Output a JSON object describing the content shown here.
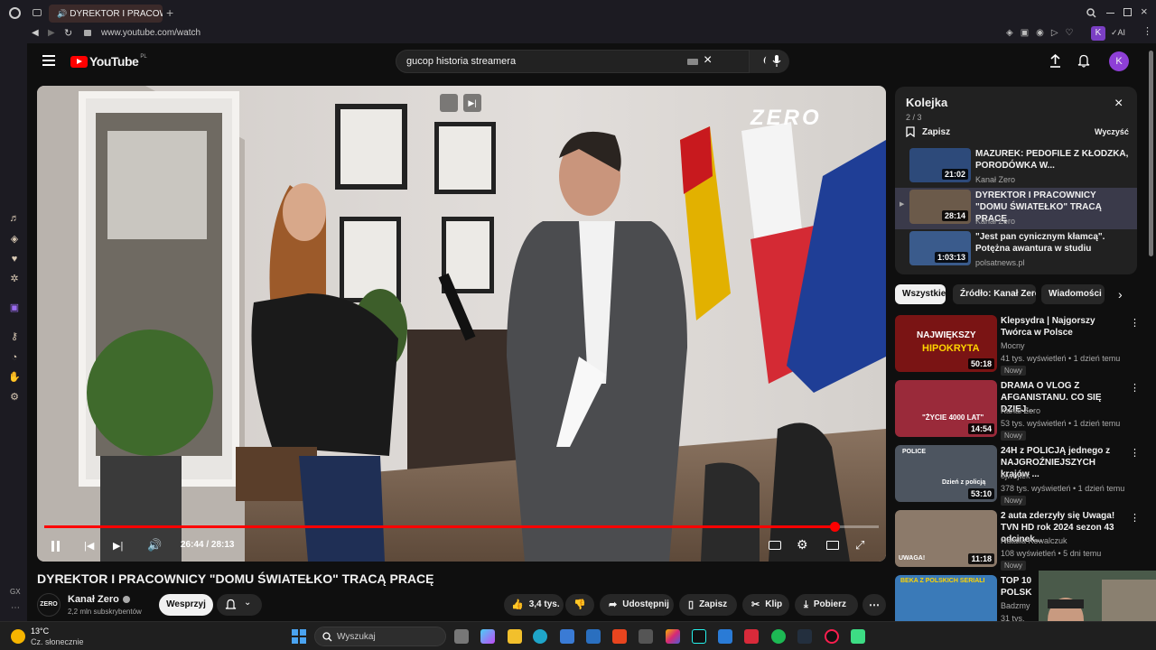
{
  "browser": {
    "tab_title": "DYREKTOR I PRACOWN",
    "url": "www.youtube.com/watch",
    "ai_label": "AI",
    "profile_initial": "K",
    "gx_label": "GX"
  },
  "youtube": {
    "logo_text": "YouTube",
    "region": "PL",
    "search_value": "gucop historia streamera",
    "avatar_initial": "K"
  },
  "player": {
    "watermark": "ZERO",
    "time_display": "26:44 / 28:13",
    "progress_fraction": 0.9473
  },
  "video": {
    "title": "DYREKTOR I PRACOWNICY \"DOMU ŚWIATEŁKO\" TRACĄ PRACĘ",
    "channel": "Kanał Zero",
    "subscribers": "2,2 mln subskrybentów",
    "support_label": "Wesprzyj",
    "likes": "3,4 tys.",
    "share_label": "Udostępnij",
    "save_label": "Zapisz",
    "clip_label": "Klip",
    "download_label": "Pobierz",
    "channel_logo_text": "ZERO"
  },
  "queue": {
    "title": "Kolejka",
    "position": "2 / 3",
    "save_label": "Zapisz",
    "clear_label": "Wyczyść",
    "items": [
      {
        "title": "MAZUREK: PEDOFILE Z KŁODZKA, PORODÓWKA W...",
        "channel": "Kanał Zero",
        "duration": "21:02",
        "color": "#2d4a7a"
      },
      {
        "title": "DYREKTOR I PRACOWNICY \"DOMU ŚWIATEŁKO\" TRACĄ PRACĘ",
        "channel": "Kanał Zero",
        "duration": "28:14",
        "color": "#6b5a4a"
      },
      {
        "title": "\"Jest pan cynicznym kłamcą\". Potężna awantura w studiu",
        "channel": "polsatnews.pl",
        "duration": "1:03:13",
        "color": "#3a5b8c"
      }
    ]
  },
  "chips": [
    "Wszystkie",
    "Źródło: Kanał Zero",
    "Wiadomości z"
  ],
  "recommendations": [
    {
      "title": "Klepsydra | Najgorszy Twórca w Polsce",
      "channel": "Mocny",
      "meta": "41 tys. wyświetleń • 1 dzień temu",
      "badge": "Nowy",
      "duration": "50:18",
      "thumb_text1": "NAJWIĘKSZY",
      "thumb_text2": "HIPOKRYTA",
      "color": "#7a1414"
    },
    {
      "title": "DRAMA O VLOG Z AFGANISTANU. CO SIĘ DZIEJ...",
      "channel": "Kanał Zero",
      "meta": "53 tys. wyświetleń • 1 dzień temu",
      "badge": "Nowy",
      "duration": "14:54",
      "thumb_text1": "\"ŻYCIE 4000 LAT\"",
      "thumb_text2": "",
      "color": "#9a2a3a"
    },
    {
      "title": "24H z POLICJĄ jednego z NAJGROŹNIEJSZYCH krajów ...",
      "channel": "ojwojtek",
      "meta": "378 tys. wyświetleń • 1 dzień temu",
      "badge": "Nowy",
      "duration": "53:10",
      "thumb_text1": "POLICE",
      "thumb_text2": "Dzień z policją",
      "color": "#4d5560"
    },
    {
      "title": "2 auta zderzyły się Uwaga! TVN HD rok 2024 sezon 43 odcinek...",
      "channel": "Natalia Kowalczuk",
      "meta": "108 wyświetleń • 5 dni temu",
      "badge": "Nowy",
      "duration": "11:18",
      "thumb_text1": "UWAGA!",
      "thumb_text2": "",
      "color": "#8c7a6a"
    },
    {
      "title": "TOP 10 POLSK",
      "channel": "Badzmy",
      "meta": "31 tys.",
      "badge": "",
      "duration": "",
      "thumb_text1": "BEKA Z POLSKICH SERIALI",
      "thumb_text2": "",
      "color": "#3a7ab8"
    }
  ],
  "taskbar": {
    "weather_temp": "13°C",
    "weather_desc": "Cz. słonecznie",
    "search_placeholder": "Wyszukaj"
  }
}
